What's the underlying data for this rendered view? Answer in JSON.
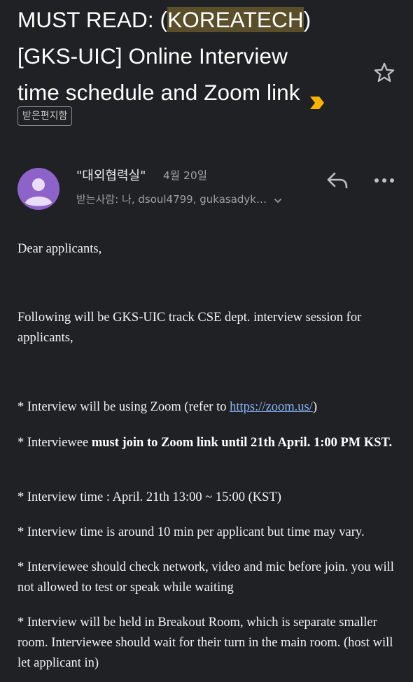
{
  "email": {
    "subject": {
      "part1": "MUST READ: (",
      "highlight": "KOREATECH",
      "part2": ")",
      "line2": "[GKS-UIC] Online Interview",
      "line3": "time schedule and Zoom link"
    },
    "label": "받은편지함",
    "sender": "\"대외협력실\"",
    "date": "4월 20일",
    "recipients": "받는사람: 나, dsoul4799, gukasadyk…",
    "body": {
      "greeting": "Dear applicants,",
      "intro": "Following will be GKS-UIC track CSE dept. interview session for applicants,",
      "item1_prefix": "* Interview will be using Zoom (refer to ",
      "item1_link": "https://zoom.us/",
      "item1_suffix": ")",
      "item2_prefix": "* Interviewee ",
      "item2_bold": "must join to Zoom link until 21th April. 1:00 PM KST.",
      "item3": "* Interview time : April. 21th 13:00 ~ 15:00 (KST)",
      "item4": "* Interview time is around 10 min per applicant but time may vary.",
      "item5": "* Interviewee should check network, video and mic before join. you will not allowed to test or speak while waiting",
      "item6": "* Interview will be held in Breakout Room, which is separate smaller room. Interviewee should wait for their turn in the main room. (host will let applicant in)"
    }
  },
  "icons": [
    "important-marker-icon",
    "star-icon",
    "avatar-icon",
    "reply-icon",
    "more-options-icon",
    "chevron-down-icon"
  ],
  "colors": {
    "background": "#202124",
    "important": "#f6b400",
    "link": "#8ab4f8",
    "avatar": "#8e63c9"
  }
}
